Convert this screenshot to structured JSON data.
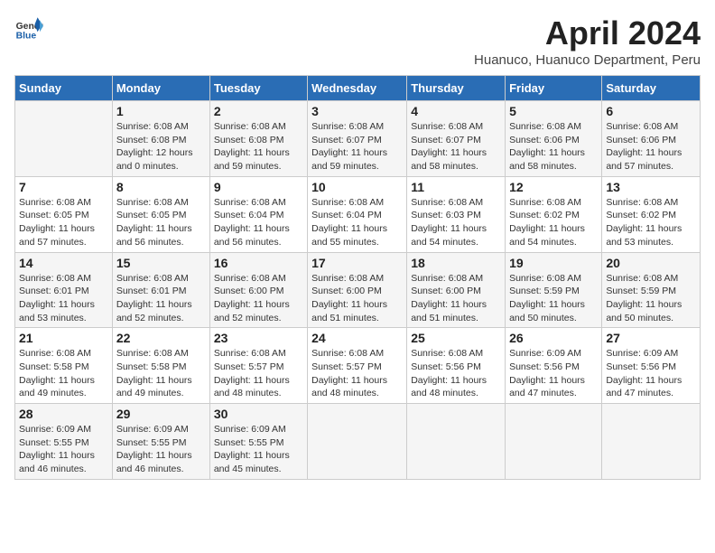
{
  "header": {
    "logo_general": "General",
    "logo_blue": "Blue",
    "month_year": "April 2024",
    "location": "Huanuco, Huanuco Department, Peru"
  },
  "days_of_week": [
    "Sunday",
    "Monday",
    "Tuesday",
    "Wednesday",
    "Thursday",
    "Friday",
    "Saturday"
  ],
  "weeks": [
    [
      {
        "day": "",
        "info": ""
      },
      {
        "day": "1",
        "info": "Sunrise: 6:08 AM\nSunset: 6:08 PM\nDaylight: 12 hours\nand 0 minutes."
      },
      {
        "day": "2",
        "info": "Sunrise: 6:08 AM\nSunset: 6:08 PM\nDaylight: 11 hours\nand 59 minutes."
      },
      {
        "day": "3",
        "info": "Sunrise: 6:08 AM\nSunset: 6:07 PM\nDaylight: 11 hours\nand 59 minutes."
      },
      {
        "day": "4",
        "info": "Sunrise: 6:08 AM\nSunset: 6:07 PM\nDaylight: 11 hours\nand 58 minutes."
      },
      {
        "day": "5",
        "info": "Sunrise: 6:08 AM\nSunset: 6:06 PM\nDaylight: 11 hours\nand 58 minutes."
      },
      {
        "day": "6",
        "info": "Sunrise: 6:08 AM\nSunset: 6:06 PM\nDaylight: 11 hours\nand 57 minutes."
      }
    ],
    [
      {
        "day": "7",
        "info": "Sunrise: 6:08 AM\nSunset: 6:05 PM\nDaylight: 11 hours\nand 57 minutes."
      },
      {
        "day": "8",
        "info": "Sunrise: 6:08 AM\nSunset: 6:05 PM\nDaylight: 11 hours\nand 56 minutes."
      },
      {
        "day": "9",
        "info": "Sunrise: 6:08 AM\nSunset: 6:04 PM\nDaylight: 11 hours\nand 56 minutes."
      },
      {
        "day": "10",
        "info": "Sunrise: 6:08 AM\nSunset: 6:04 PM\nDaylight: 11 hours\nand 55 minutes."
      },
      {
        "day": "11",
        "info": "Sunrise: 6:08 AM\nSunset: 6:03 PM\nDaylight: 11 hours\nand 54 minutes."
      },
      {
        "day": "12",
        "info": "Sunrise: 6:08 AM\nSunset: 6:02 PM\nDaylight: 11 hours\nand 54 minutes."
      },
      {
        "day": "13",
        "info": "Sunrise: 6:08 AM\nSunset: 6:02 PM\nDaylight: 11 hours\nand 53 minutes."
      }
    ],
    [
      {
        "day": "14",
        "info": "Sunrise: 6:08 AM\nSunset: 6:01 PM\nDaylight: 11 hours\nand 53 minutes."
      },
      {
        "day": "15",
        "info": "Sunrise: 6:08 AM\nSunset: 6:01 PM\nDaylight: 11 hours\nand 52 minutes."
      },
      {
        "day": "16",
        "info": "Sunrise: 6:08 AM\nSunset: 6:00 PM\nDaylight: 11 hours\nand 52 minutes."
      },
      {
        "day": "17",
        "info": "Sunrise: 6:08 AM\nSunset: 6:00 PM\nDaylight: 11 hours\nand 51 minutes."
      },
      {
        "day": "18",
        "info": "Sunrise: 6:08 AM\nSunset: 6:00 PM\nDaylight: 11 hours\nand 51 minutes."
      },
      {
        "day": "19",
        "info": "Sunrise: 6:08 AM\nSunset: 5:59 PM\nDaylight: 11 hours\nand 50 minutes."
      },
      {
        "day": "20",
        "info": "Sunrise: 6:08 AM\nSunset: 5:59 PM\nDaylight: 11 hours\nand 50 minutes."
      }
    ],
    [
      {
        "day": "21",
        "info": "Sunrise: 6:08 AM\nSunset: 5:58 PM\nDaylight: 11 hours\nand 49 minutes."
      },
      {
        "day": "22",
        "info": "Sunrise: 6:08 AM\nSunset: 5:58 PM\nDaylight: 11 hours\nand 49 minutes."
      },
      {
        "day": "23",
        "info": "Sunrise: 6:08 AM\nSunset: 5:57 PM\nDaylight: 11 hours\nand 48 minutes."
      },
      {
        "day": "24",
        "info": "Sunrise: 6:08 AM\nSunset: 5:57 PM\nDaylight: 11 hours\nand 48 minutes."
      },
      {
        "day": "25",
        "info": "Sunrise: 6:08 AM\nSunset: 5:56 PM\nDaylight: 11 hours\nand 48 minutes."
      },
      {
        "day": "26",
        "info": "Sunrise: 6:09 AM\nSunset: 5:56 PM\nDaylight: 11 hours\nand 47 minutes."
      },
      {
        "day": "27",
        "info": "Sunrise: 6:09 AM\nSunset: 5:56 PM\nDaylight: 11 hours\nand 47 minutes."
      }
    ],
    [
      {
        "day": "28",
        "info": "Sunrise: 6:09 AM\nSunset: 5:55 PM\nDaylight: 11 hours\nand 46 minutes."
      },
      {
        "day": "29",
        "info": "Sunrise: 6:09 AM\nSunset: 5:55 PM\nDaylight: 11 hours\nand 46 minutes."
      },
      {
        "day": "30",
        "info": "Sunrise: 6:09 AM\nSunset: 5:55 PM\nDaylight: 11 hours\nand 45 minutes."
      },
      {
        "day": "",
        "info": ""
      },
      {
        "day": "",
        "info": ""
      },
      {
        "day": "",
        "info": ""
      },
      {
        "day": "",
        "info": ""
      }
    ]
  ]
}
